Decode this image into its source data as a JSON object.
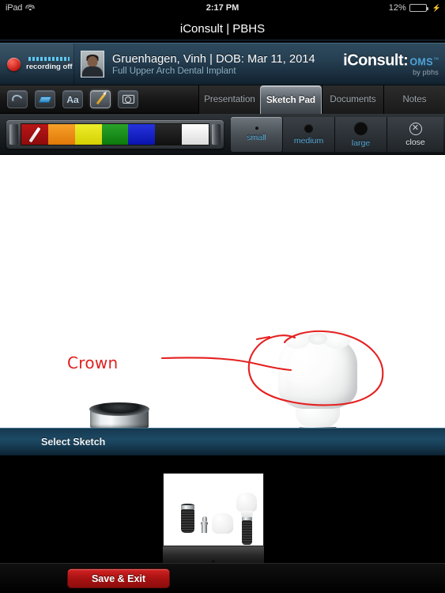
{
  "status_bar": {
    "carrier": "iPad",
    "wifi_icon": "wifi-icon",
    "time": "2:17 PM",
    "battery_percent": "12%",
    "battery_level": 12,
    "charging_icon": "lightning-bolt-icon"
  },
  "app": {
    "title": "iConsult | PBHS"
  },
  "patient_bar": {
    "recording_label": "recording off",
    "recording_state": "off",
    "record_icon": "record-dot-icon",
    "avatar_alt": "patient-photo",
    "patient_name": "Gruenhagen, Vinh | DOB: Mar 11, 2014",
    "procedure": "Full Upper Arch Dental Implant",
    "brand_primary": "iConsult:",
    "brand_secondary": "OMS",
    "brand_tm": "™",
    "brand_tagline": "by pbhs"
  },
  "toolbar": {
    "tools": [
      {
        "name": "undo-icon",
        "label": ""
      },
      {
        "name": "eraser-icon",
        "label": ""
      },
      {
        "name": "text-tool-icon",
        "label": "Aa"
      },
      {
        "name": "pencil-icon",
        "label": ""
      },
      {
        "name": "camera-icon",
        "label": ""
      }
    ],
    "active_tool": "pencil-icon",
    "tabs": [
      {
        "label": "Presentation",
        "active": false
      },
      {
        "label": "Sketch Pad",
        "active": true
      },
      {
        "label": "Documents",
        "active": false
      },
      {
        "label": "Notes",
        "active": false
      }
    ]
  },
  "palette_bar": {
    "colors": [
      {
        "name": "red",
        "hex": "#a50f0f",
        "selected": true
      },
      {
        "name": "orange",
        "hex": "#ef8a16",
        "selected": false
      },
      {
        "name": "yellow",
        "hex": "#e4e114",
        "selected": false
      },
      {
        "name": "green",
        "hex": "#1a8c1a",
        "selected": false
      },
      {
        "name": "blue",
        "hex": "#1122c9",
        "selected": false
      },
      {
        "name": "black",
        "hex": "#1a1a1a",
        "selected": false
      },
      {
        "name": "white",
        "hex": "#f2f2f2",
        "selected": false
      }
    ],
    "sizes": [
      {
        "label": "small",
        "selected": true
      },
      {
        "label": "medium",
        "selected": false
      },
      {
        "label": "large",
        "selected": false
      }
    ],
    "close_label": "close",
    "close_icon": "circle-x-icon"
  },
  "canvas": {
    "annotation_text": "Crown",
    "annotation_color": "#e02020",
    "annotation_shapes": [
      "leader-line",
      "ellipse-circle"
    ],
    "image_alt": "dental-implant-components-diagram",
    "parts": [
      "implant-screw",
      "abutment",
      "crown",
      "assembled-implant-crown"
    ]
  },
  "sketch_selector": {
    "header": "Select Sketch",
    "thumbnails": [
      {
        "alt": "dental-implant-sketch-thumbnail",
        "selected": true
      }
    ]
  },
  "bottom_bar": {
    "save_label": "Save & Exit"
  }
}
